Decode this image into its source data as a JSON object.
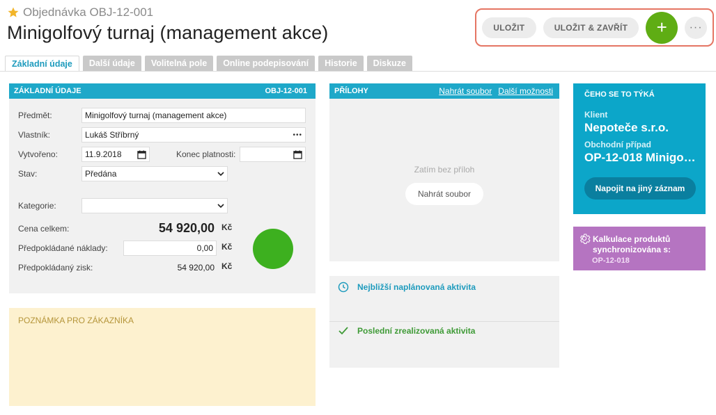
{
  "header": {
    "breadcrumb": "Objednávka OBJ-12-001",
    "title": "Minigolfový turnaj (management akce)"
  },
  "toolbar": {
    "save_label": "ULOŽIT",
    "save_close_label": "ULOŽIT & ZAVŘÍT",
    "add_label": "+",
    "more_label": "···"
  },
  "tabs": [
    {
      "label": "Základní údaje",
      "active": true
    },
    {
      "label": "Další údaje"
    },
    {
      "label": "Volitelná pole"
    },
    {
      "label": "Online podepisování"
    },
    {
      "label": "Historie"
    },
    {
      "label": "Diskuze"
    }
  ],
  "basic": {
    "title": "ZÁKLADNÍ ÚDAJE",
    "code": "OBJ-12-001",
    "subject_label": "Předmět:",
    "subject_value": "Minigolfový turnaj (management akce)",
    "owner_label": "Vlastník:",
    "owner_value": "Lukáš Stříbrný",
    "owner_more": "•••",
    "created_label": "Vytvořeno:",
    "created_value": "11.9.2018",
    "validity_label": "Konec platnosti:",
    "validity_value": "",
    "status_label": "Stav:",
    "status_value": "Předána",
    "category_label": "Kategorie:",
    "category_value": "",
    "total_label": "Cena celkem:",
    "total_value": "54 920,00",
    "costs_label": "Předpokládané náklady:",
    "costs_value": "0,00",
    "profit_label": "Předpokládaný zisk:",
    "profit_value": "54 920,00",
    "currency": "Kč"
  },
  "note": {
    "title": "POZNÁMKA PRO ZÁKAZNÍKA"
  },
  "attachments": {
    "title": "PŘÍLOHY",
    "upload_link": "Nahrát soubor",
    "more_link": "Další možnosti",
    "empty_text": "Zatím bez příloh",
    "upload_button": "Nahrát soubor"
  },
  "activities": {
    "next_label": "Nejbližší naplánovaná aktivita",
    "last_label": "Poslední zrealizovaná aktivita"
  },
  "related": {
    "title": "ČEHO SE TO TÝKÁ",
    "client_label": "Klient",
    "client_value": "Nepoteče s.r.o.",
    "case_label": "Obchodní případ",
    "case_value": "OP-12-018 Minigo…",
    "button": "Napojit na jiný záznam"
  },
  "calc": {
    "text": "Kalkulace produktů synchronizována s:",
    "ref": "OP-12-018"
  },
  "colors": {
    "accent": "#1ea8c9",
    "related_bg": "#0ca6c9",
    "calc_bg": "#b574c1",
    "add_button": "#5fad14",
    "note_bg": "#fdf1cf",
    "toolbar_outline": "#e57563"
  }
}
